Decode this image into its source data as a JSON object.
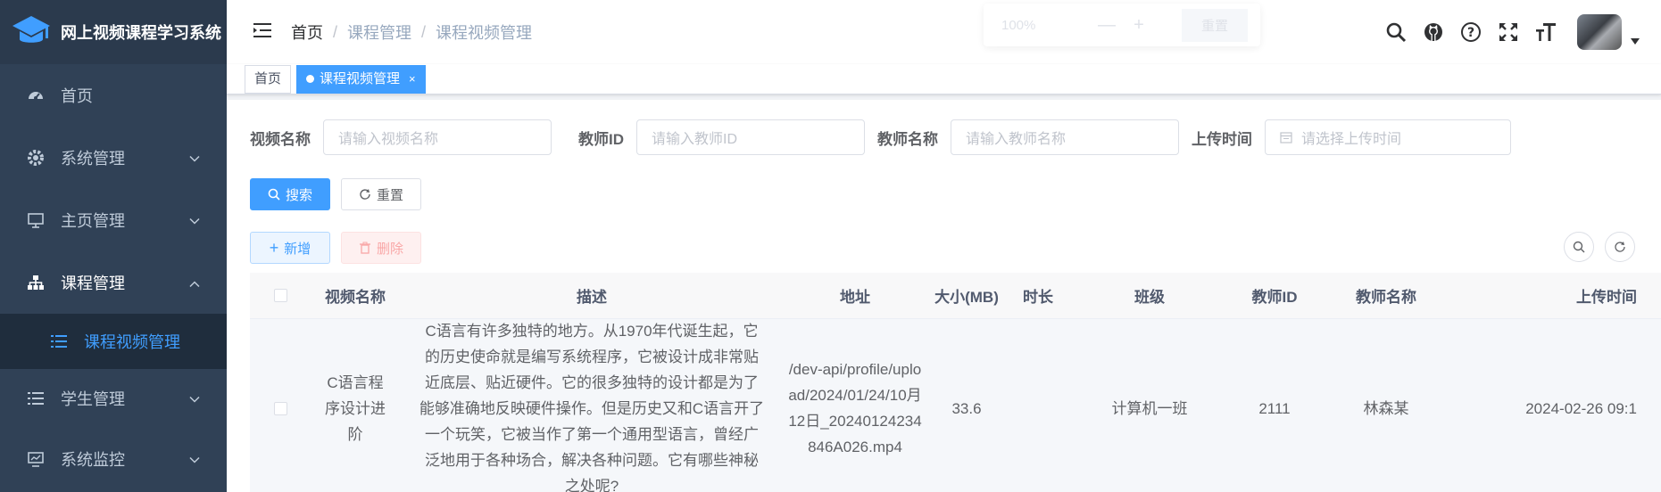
{
  "app": {
    "title": "网上视频课程学习系统"
  },
  "sidebar": {
    "items": [
      {
        "label": "首页",
        "icon": "dashboard-icon"
      },
      {
        "label": "系统管理",
        "icon": "gear-icon"
      },
      {
        "label": "主页管理",
        "icon": "monitor-icon"
      },
      {
        "label": "课程管理",
        "icon": "tree-icon"
      },
      {
        "label": "学生管理",
        "icon": "list-icon"
      },
      {
        "label": "系统监控",
        "icon": "monitor-chart-icon"
      }
    ],
    "submenu": {
      "label": "课程视频管理",
      "icon": "list-icon"
    }
  },
  "header": {
    "breadcrumb": {
      "home": "首页",
      "level1": "课程管理",
      "level2": "课程视频管理"
    },
    "zoom": {
      "value": "100%",
      "minus": "—",
      "plus": "+",
      "reset": "重置"
    }
  },
  "tags": {
    "home": "首页",
    "active": "课程视频管理",
    "close": "×"
  },
  "search_form": {
    "video_name": {
      "label": "视频名称",
      "placeholder": "请输入视频名称"
    },
    "teacher_id": {
      "label": "教师ID",
      "placeholder": "请输入教师ID"
    },
    "teacher_name": {
      "label": "教师名称",
      "placeholder": "请输入教师名称"
    },
    "upload_time": {
      "label": "上传时间",
      "placeholder": "请选择上传时间"
    },
    "search_label": "搜索",
    "reset_label": "重置"
  },
  "toolbar": {
    "add_label": "新增",
    "delete_label": "删除"
  },
  "table": {
    "headers": [
      "视频名称",
      "描述",
      "地址",
      "大小(MB)",
      "时长",
      "班级",
      "教师ID",
      "教师名称",
      "上传时间"
    ],
    "rows": [
      {
        "name": "C语言程序设计进阶",
        "desc": "C语言有许多独特的地方。从1970年代诞生起，它的历史使命就是编写系统程序，它被设计成非常贴近底层、贴近硬件。它的很多独特的设计都是为了能够准确地反映硬件操作。但是历史又和C语言开了一个玩笑，它被当作了第一个通用型语言，曾经广泛地用于各种场合，解决各种问题。它有哪些神秘之处呢?",
        "url": "/dev-api/profile/upload/2024/01/24/10月12日_20240124234846A026.mp4",
        "size": "33.6",
        "duration": "",
        "class": "计算机一班",
        "teacher_id": "2111",
        "teacher_name": "林森某",
        "upload_time": "2024-02-26 09:1"
      }
    ]
  },
  "colors": {
    "sidebar_bg": "#304156",
    "accent": "#409eff",
    "danger": "#f56c6c"
  }
}
